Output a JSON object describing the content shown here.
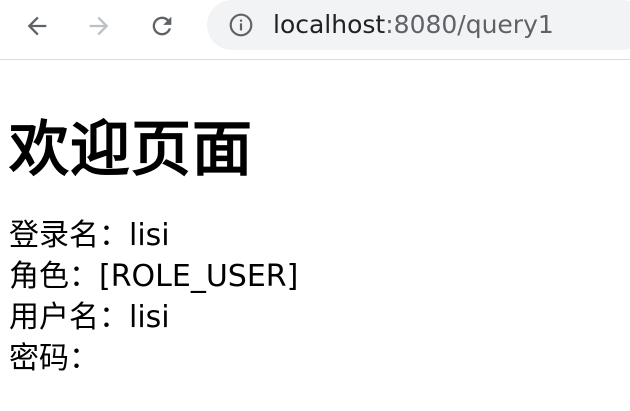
{
  "browser": {
    "url_host": "localhost",
    "url_rest": ":8080/query1",
    "icons": {
      "back": "back-arrow-icon",
      "forward": "forward-arrow-icon",
      "reload": "reload-icon",
      "info": "info-icon"
    },
    "colors": {
      "icon_active": "#5f6368",
      "icon_disabled": "#bdc1c6",
      "omnibox_bg": "#f1f3f4"
    }
  },
  "page": {
    "title": "欢迎页面",
    "lines": [
      {
        "label": "登录名：",
        "value": "lisi"
      },
      {
        "label": "角色：",
        "value": "[ROLE_USER]"
      },
      {
        "label": "用户名：",
        "value": "lisi"
      },
      {
        "label": "密码：",
        "value": ""
      }
    ]
  }
}
